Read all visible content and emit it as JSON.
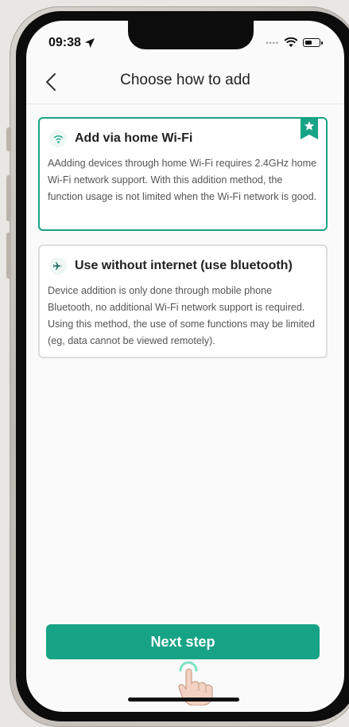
{
  "status": {
    "time": "09:38"
  },
  "nav": {
    "title": "Choose how to add"
  },
  "options": [
    {
      "title": "Add via home Wi-Fi",
      "description": "AAdding devices through home Wi-Fi requires 2.4GHz home Wi-Fi network support. With this addition method, the function usage is not limited when the Wi-Fi network is good.",
      "icon": "wifi-icon",
      "selected": true
    },
    {
      "title": "Use without internet (use bluetooth)",
      "description": "Device addition is only done through mobile phone Bluetooth, no additional Wi-Fi network support is required. Using this method, the use of some functions may be limited (eg, data cannot be viewed remotely).",
      "icon": "airplane-icon",
      "selected": false
    }
  ],
  "footer": {
    "next_label": "Next step"
  },
  "colors": {
    "accent": "#17a386",
    "border": "#dcdcdc"
  }
}
